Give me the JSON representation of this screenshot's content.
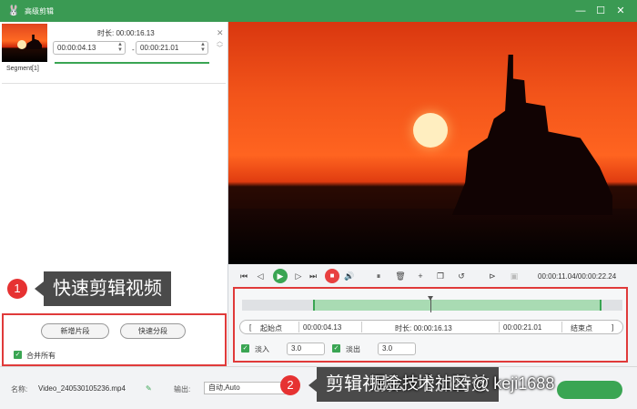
{
  "window": {
    "title": "高级剪辑",
    "logo_icon": "rabbit-logo",
    "controls": [
      "minimize",
      "maximize",
      "close"
    ]
  },
  "segment": {
    "label": "Segment[1]",
    "duration_label": "时长: 00:00:16.13",
    "start": "00:00:04.13",
    "end": "00:00:21.01",
    "separator": "-"
  },
  "playback": {
    "timecode": "00:00:11.04/00:00:22.24"
  },
  "trim": {
    "start_button": "起始点",
    "start_time": "00:00:04.13",
    "duration": "时长: 00:00:16.13",
    "end_time": "00:00:21.01",
    "end_button": "结束点",
    "selection_start": 0.1856,
    "selection_end": 0.9449,
    "playhead": 0.4955
  },
  "fade": {
    "in_label": "淡入",
    "in_value": "3.0",
    "out_label": "淡出",
    "out_value": "3.0"
  },
  "left_actions": {
    "new_segment": "新增片段",
    "quick_split": "快速分段",
    "merge_all": "合并所有"
  },
  "bottom": {
    "name_label": "名称:",
    "name_value": "Video_240530105236.mp4",
    "output_label": "输出:",
    "output_value": "自动,Auto"
  },
  "callouts": [
    {
      "number": "1",
      "text": "快速剪辑视频"
    },
    {
      "number": "2",
      "text": "剪辑视频、增加特效"
    }
  ],
  "watermark": "掘金技术社区 @ keji1688",
  "colors": {
    "accent": "#3aa553",
    "titlebar": "#3a9a53",
    "highlight": "#e03a3a",
    "stop": "#e84040"
  }
}
